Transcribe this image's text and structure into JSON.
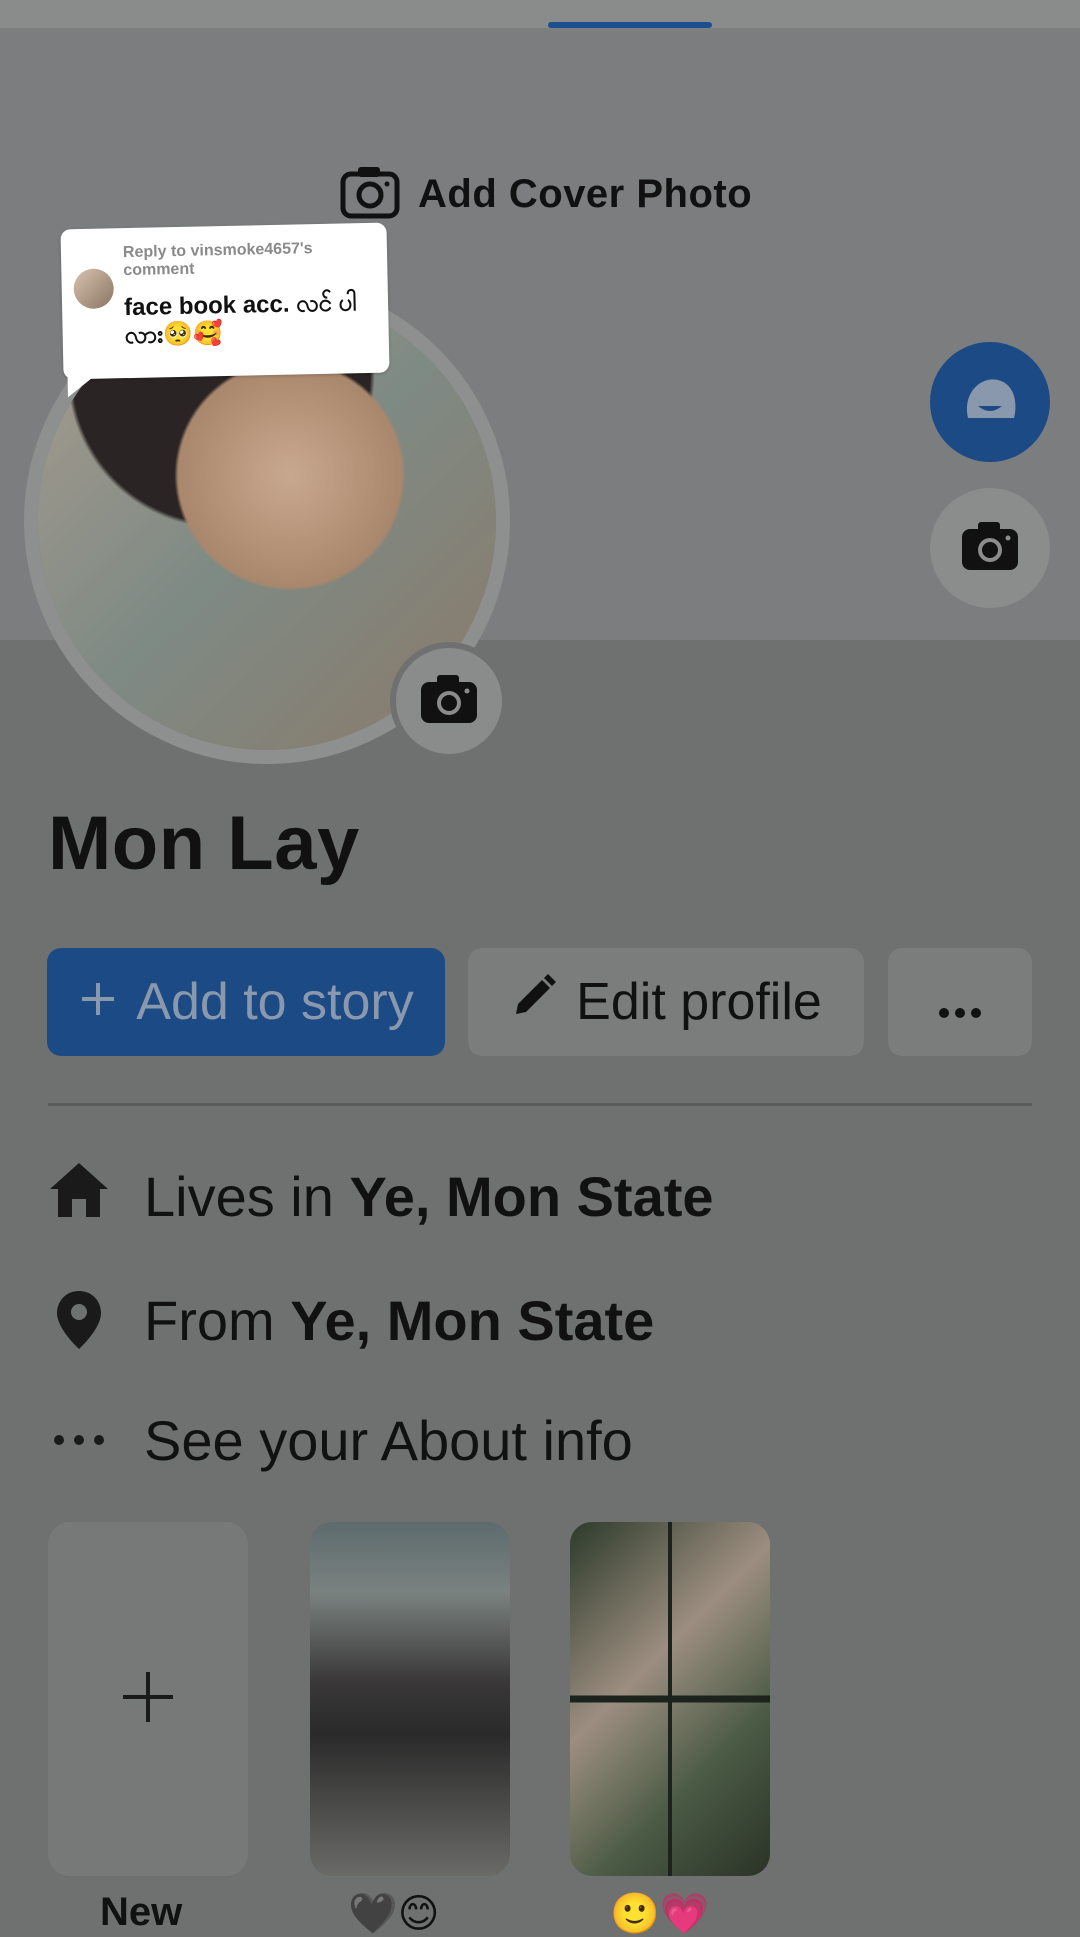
{
  "cover": {
    "add_cover_label": "Add Cover Photo"
  },
  "comment": {
    "reply_to": "Reply to vinsmoke4657's comment",
    "text": "face book acc. လင် ပါ လား🥺🥰"
  },
  "profile": {
    "name": "Mon Lay"
  },
  "actions": {
    "add_story_label": "Add to story",
    "edit_profile_label": "Edit profile",
    "more_label": "..."
  },
  "info": {
    "lives_prefix": "Lives in",
    "lives_value": "Ye, Mon State",
    "from_prefix": "From",
    "from_value": "Ye, Mon State",
    "about_label": "See your About info"
  },
  "stories": {
    "new_label": "New",
    "story1_caption": "🖤😊",
    "story2_caption": "🙂💗"
  },
  "colors": {
    "accent": "#1c4a85",
    "background": "#6f7170"
  },
  "icons": {
    "camera": "camera-icon",
    "home": "home-icon",
    "pin": "location-pin-icon",
    "more": "more-dots-icon",
    "pencil": "pencil-icon",
    "plus": "plus-icon"
  }
}
